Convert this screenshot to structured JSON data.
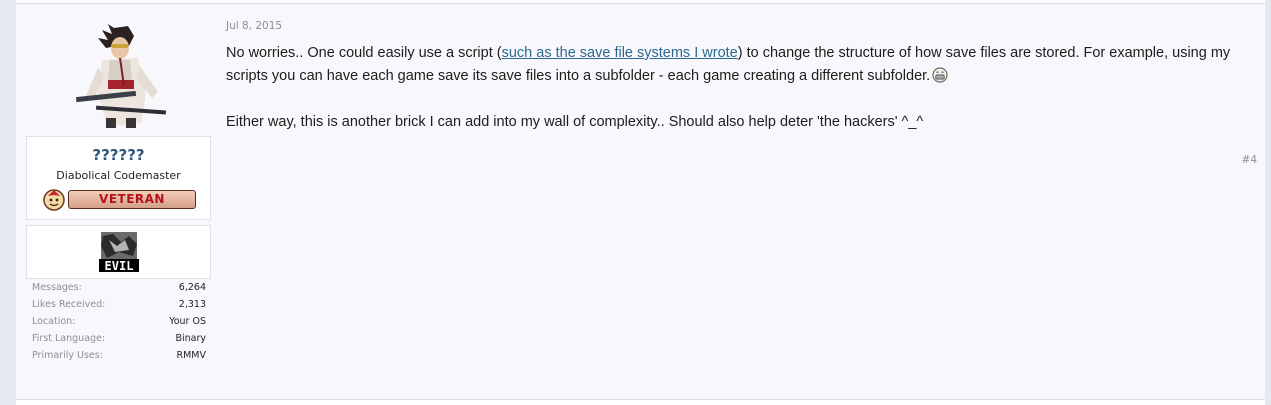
{
  "post": {
    "date": "Jul 8, 2015",
    "number": "#4",
    "message": {
      "line1_before_link": "No worries.. One could easily use a script (",
      "link_text": "such as the save file systems I wrote",
      "line1_after_link": ") to change the structure of how save files are stored. For example, using my scripts you can have each game save its save files into a subfolder - each game creating a different subfolder.",
      "emoji": "grin-emoji",
      "line2": "Either way, this is another brick I can add into my wall of complexity.. Should also help deter 'the hackers' ^_^"
    }
  },
  "user": {
    "name": "??????",
    "title": "Diabolical Codemaster",
    "badge": "VETERAN",
    "banner_text": "EVIL",
    "stats": [
      {
        "label": "Messages:",
        "value": "6,264"
      },
      {
        "label": "Likes Received:",
        "value": "2,313"
      },
      {
        "label": "Location:",
        "value": "Your OS"
      },
      {
        "label": "First Language:",
        "value": "Binary"
      },
      {
        "label": "Primarily Uses:",
        "value": "RMMV"
      }
    ]
  },
  "colors": {
    "username": "#2f557d",
    "link": "#2b6a8e",
    "badge_text": "#b2141e",
    "muted": "#8a8e98"
  }
}
